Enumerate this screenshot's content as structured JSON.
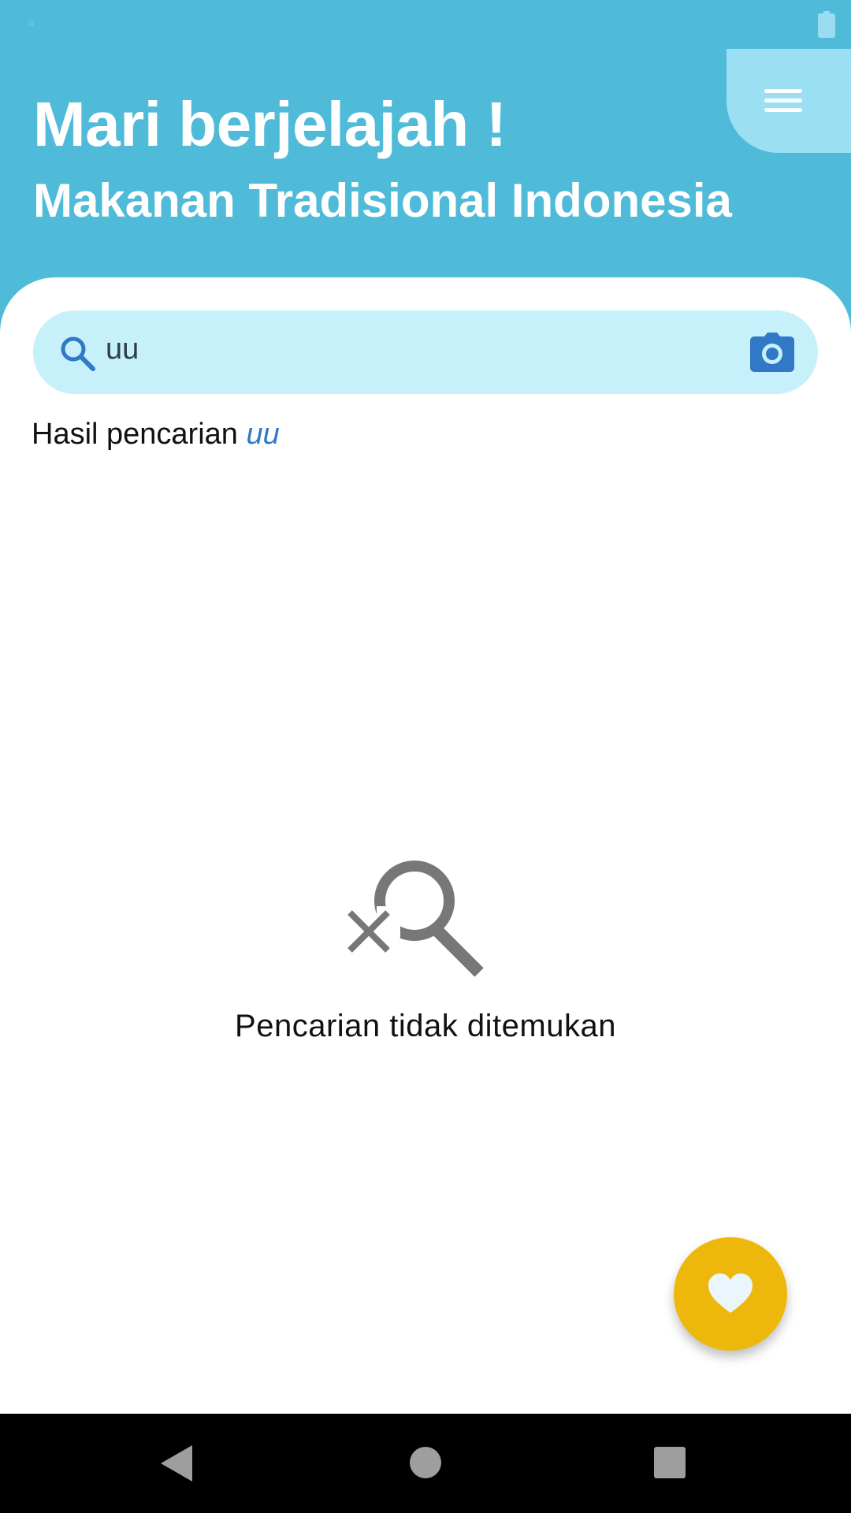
{
  "header": {
    "title": "Mari berjelajah !",
    "subtitle": "Makanan Tradisional Indonesia"
  },
  "icons": {
    "menu": "hamburger-menu-icon",
    "search": "search-icon",
    "camera": "camera-icon",
    "empty": "search-not-found-icon",
    "favorite": "heart-icon"
  },
  "search": {
    "value": "uu"
  },
  "results": {
    "label_prefix": "Hasil pencarian",
    "query": "uu",
    "empty_message": "Pencarian tidak ditemukan"
  },
  "colors": {
    "header_bg": "#50BAD9",
    "menu_button_bg": "#9BDFF3",
    "search_bg": "#C6F0FA",
    "accent_blue": "#3178C6",
    "fab_bg": "#EDB80B"
  }
}
